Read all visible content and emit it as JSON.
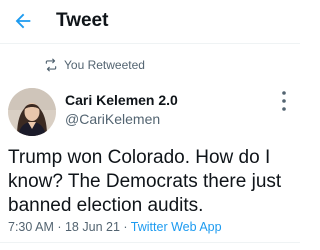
{
  "header": {
    "back_icon": "arrow-left-icon",
    "title": "Tweet"
  },
  "social_context": {
    "icon": "retweet-icon",
    "text": "You Retweeted"
  },
  "author": {
    "name": "Cari Kelemen 2.0",
    "handle": "@CariKelemen"
  },
  "tweet": {
    "text": "Trump won Colorado. How do I know? The Democrats there just banned election audits."
  },
  "meta": {
    "time": "7:30 AM",
    "separator1": " · ",
    "date": "18 Jun 21",
    "separator2": " · ",
    "source": "Twitter Web App"
  },
  "colors": {
    "accent": "#1d9bf0",
    "text_primary": "#0f1419",
    "text_secondary": "#536471",
    "divider": "#eff3f4"
  }
}
